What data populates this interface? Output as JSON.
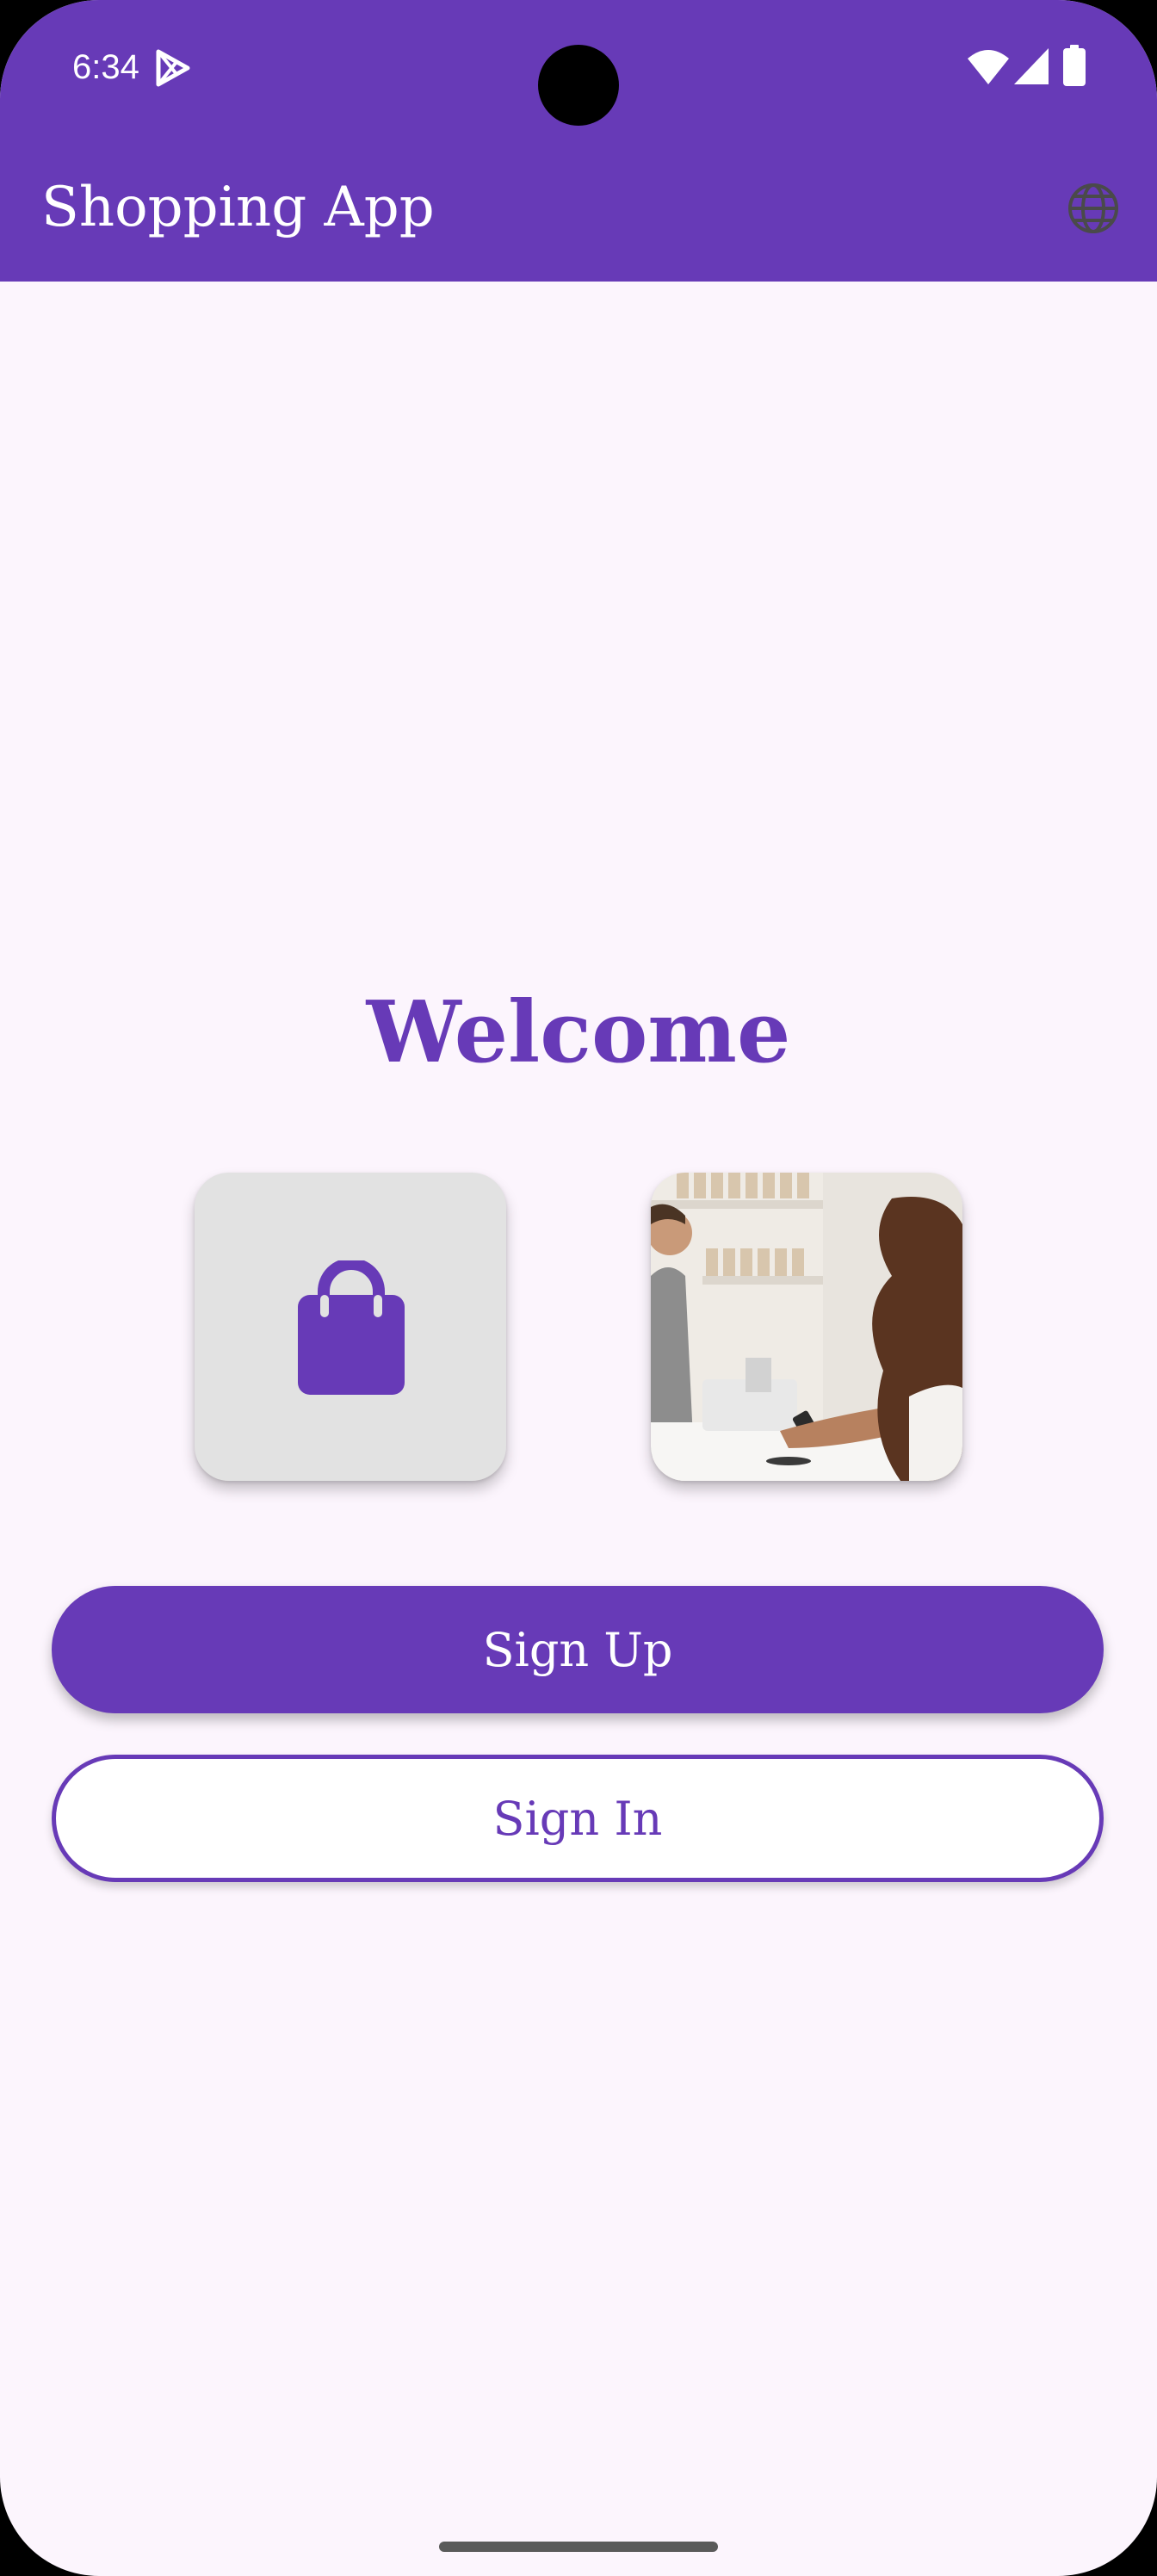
{
  "status_bar": {
    "time": "6:34",
    "icons": [
      "play-store-icon",
      "wifi-icon",
      "signal-icon",
      "battery-icon"
    ]
  },
  "app_bar": {
    "title": "Shopping App",
    "action_icon": "globe-icon"
  },
  "main": {
    "heading": "Welcome",
    "tiles": [
      {
        "icon": "shopping-bag-icon"
      },
      {
        "image": "checkout-photo"
      }
    ],
    "buttons": {
      "sign_up": "Sign Up",
      "sign_in": "Sign In"
    }
  },
  "colors": {
    "primary": "#673ab7",
    "background": "#fcf5fd",
    "tile_gray": "#e2e2e2",
    "on_primary": "#ffffff"
  }
}
